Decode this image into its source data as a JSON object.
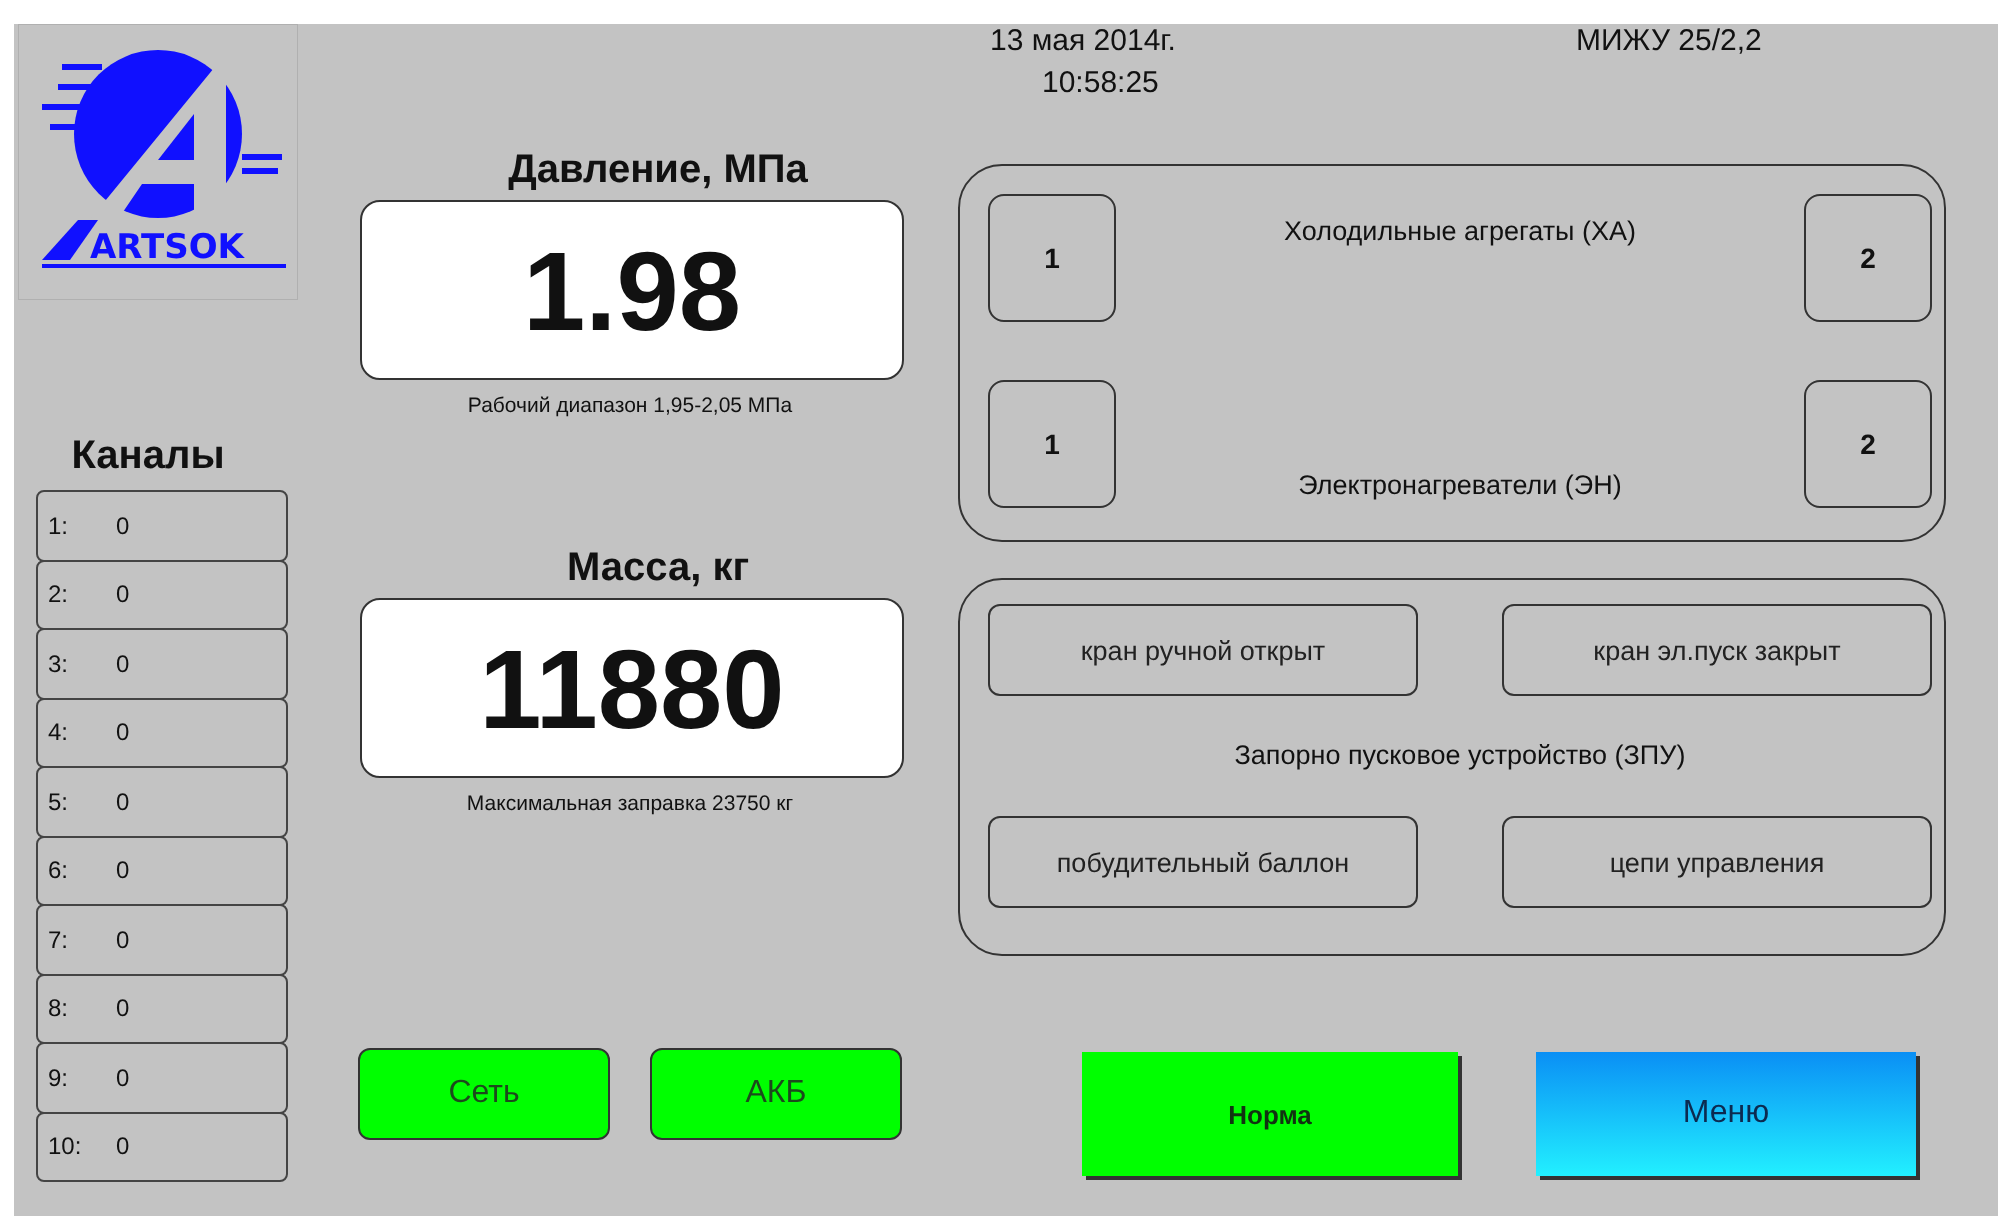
{
  "logo": {
    "text": "ARTSOK"
  },
  "channels_title": "Каналы",
  "channels": [
    {
      "label": "1:",
      "value": "0"
    },
    {
      "label": "2:",
      "value": "0"
    },
    {
      "label": "3:",
      "value": "0"
    },
    {
      "label": "4:",
      "value": "0"
    },
    {
      "label": "5:",
      "value": "0"
    },
    {
      "label": "6:",
      "value": "0"
    },
    {
      "label": "7:",
      "value": "0"
    },
    {
      "label": "8:",
      "value": "0"
    },
    {
      "label": "9:",
      "value": "0"
    },
    {
      "label": "10:",
      "value": "0"
    }
  ],
  "readouts": [
    {
      "title": "Давление, МПа",
      "value": "1.98",
      "note": "Рабочий диапазон 1,95-2,05 МПа"
    },
    {
      "title": "Масса, кг",
      "value": "11880",
      "note": "Максимальная заправка 23750 кг"
    }
  ],
  "power": [
    {
      "label": "Сеть",
      "color": "#00ff00"
    },
    {
      "label": "АКБ",
      "color": "#00ff00"
    }
  ],
  "date": "13 мая 2014г.",
  "time": "10:58:25",
  "device": "МИЖУ 25/2,2",
  "units": [
    {
      "label": "Холодильные агрегаты (ХА)",
      "buttons": [
        "1",
        "2"
      ]
    },
    {
      "label": "Электронагреватели (ЭН)",
      "buttons": [
        "1",
        "2"
      ]
    }
  ],
  "zpu": {
    "label": "Запорно пусковое устройство (ЗПУ)",
    "top": [
      "кран ручной открыт",
      "кран эл.пуск закрыт"
    ],
    "bottom": [
      "побудительный баллон",
      "цепи управления"
    ]
  },
  "status": {
    "label": "Норма",
    "color": "#00ff00"
  },
  "menu": "Меню"
}
